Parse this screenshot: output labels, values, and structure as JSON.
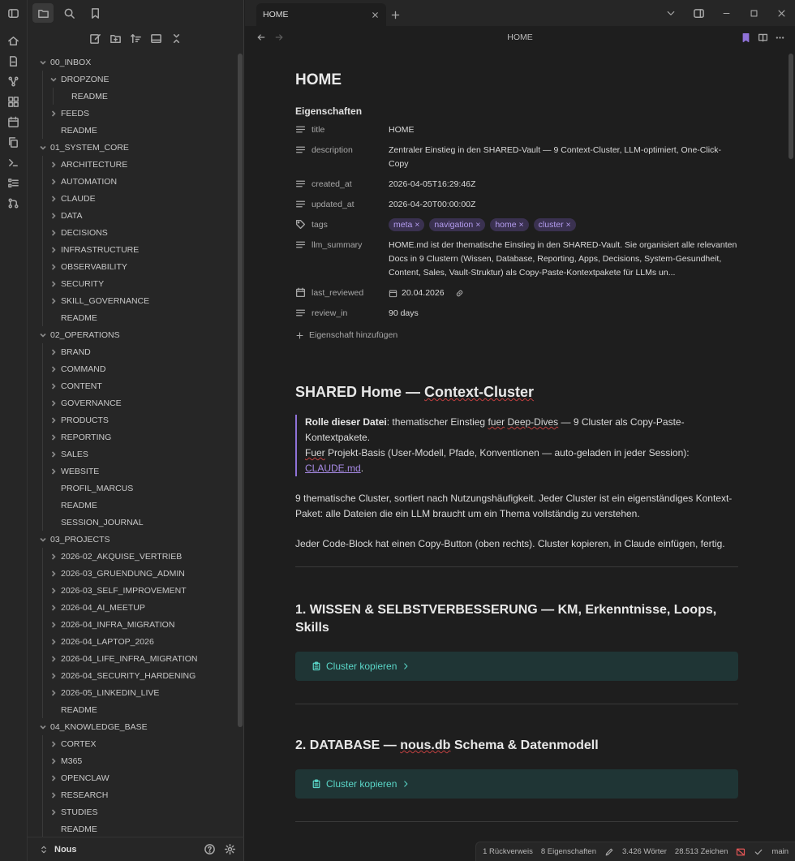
{
  "sidebar": {
    "footer": {
      "vault": "Nous"
    },
    "tree": [
      {
        "label": "00_INBOX",
        "depth": 0,
        "folder": true,
        "open": true
      },
      {
        "label": "DROPZONE",
        "depth": 1,
        "folder": true,
        "open": true
      },
      {
        "label": "README",
        "depth": 2,
        "folder": false
      },
      {
        "label": "FEEDS",
        "depth": 1,
        "folder": true,
        "open": false
      },
      {
        "label": "README",
        "depth": 1,
        "folder": false
      },
      {
        "label": "01_SYSTEM_CORE",
        "depth": 0,
        "folder": true,
        "open": true
      },
      {
        "label": "ARCHITECTURE",
        "depth": 1,
        "folder": true,
        "open": false
      },
      {
        "label": "AUTOMATION",
        "depth": 1,
        "folder": true,
        "open": false
      },
      {
        "label": "CLAUDE",
        "depth": 1,
        "folder": true,
        "open": false
      },
      {
        "label": "DATA",
        "depth": 1,
        "folder": true,
        "open": false
      },
      {
        "label": "DECISIONS",
        "depth": 1,
        "folder": true,
        "open": false
      },
      {
        "label": "INFRASTRUCTURE",
        "depth": 1,
        "folder": true,
        "open": false
      },
      {
        "label": "OBSERVABILITY",
        "depth": 1,
        "folder": true,
        "open": false
      },
      {
        "label": "SECURITY",
        "depth": 1,
        "folder": true,
        "open": false
      },
      {
        "label": "SKILL_GOVERNANCE",
        "depth": 1,
        "folder": true,
        "open": false
      },
      {
        "label": "README",
        "depth": 1,
        "folder": false
      },
      {
        "label": "02_OPERATIONS",
        "depth": 0,
        "folder": true,
        "open": true
      },
      {
        "label": "BRAND",
        "depth": 1,
        "folder": true,
        "open": false
      },
      {
        "label": "COMMAND",
        "depth": 1,
        "folder": true,
        "open": false
      },
      {
        "label": "CONTENT",
        "depth": 1,
        "folder": true,
        "open": false
      },
      {
        "label": "GOVERNANCE",
        "depth": 1,
        "folder": true,
        "open": false
      },
      {
        "label": "PRODUCTS",
        "depth": 1,
        "folder": true,
        "open": false
      },
      {
        "label": "REPORTING",
        "depth": 1,
        "folder": true,
        "open": false
      },
      {
        "label": "SALES",
        "depth": 1,
        "folder": true,
        "open": false
      },
      {
        "label": "WEBSITE",
        "depth": 1,
        "folder": true,
        "open": false
      },
      {
        "label": "PROFIL_MARCUS",
        "depth": 1,
        "folder": false
      },
      {
        "label": "README",
        "depth": 1,
        "folder": false
      },
      {
        "label": "SESSION_JOURNAL",
        "depth": 1,
        "folder": false
      },
      {
        "label": "03_PROJECTS",
        "depth": 0,
        "folder": true,
        "open": true
      },
      {
        "label": "2026-02_AKQUISE_VERTRIEB",
        "depth": 1,
        "folder": true,
        "open": false
      },
      {
        "label": "2026-03_GRUENDUNG_ADMIN",
        "depth": 1,
        "folder": true,
        "open": false
      },
      {
        "label": "2026-03_SELF_IMPROVEMENT",
        "depth": 1,
        "folder": true,
        "open": false
      },
      {
        "label": "2026-04_AI_MEETUP",
        "depth": 1,
        "folder": true,
        "open": false
      },
      {
        "label": "2026-04_INFRA_MIGRATION",
        "depth": 1,
        "folder": true,
        "open": false
      },
      {
        "label": "2026-04_LAPTOP_2026",
        "depth": 1,
        "folder": true,
        "open": false
      },
      {
        "label": "2026-04_LIFE_INFRA_MIGRATION",
        "depth": 1,
        "folder": true,
        "open": false
      },
      {
        "label": "2026-04_SECURITY_HARDENING",
        "depth": 1,
        "folder": true,
        "open": false
      },
      {
        "label": "2026-05_LINKEDIN_LIVE",
        "depth": 1,
        "folder": true,
        "open": false
      },
      {
        "label": "README",
        "depth": 1,
        "folder": false
      },
      {
        "label": "04_KNOWLEDGE_BASE",
        "depth": 0,
        "folder": true,
        "open": true
      },
      {
        "label": "CORTEX",
        "depth": 1,
        "folder": true,
        "open": false
      },
      {
        "label": "M365",
        "depth": 1,
        "folder": true,
        "open": false
      },
      {
        "label": "OPENCLAW",
        "depth": 1,
        "folder": true,
        "open": false
      },
      {
        "label": "RESEARCH",
        "depth": 1,
        "folder": true,
        "open": false
      },
      {
        "label": "STUDIES",
        "depth": 1,
        "folder": true,
        "open": false
      },
      {
        "label": "README",
        "depth": 1,
        "folder": false
      }
    ]
  },
  "tab": {
    "title": "HOME"
  },
  "view": {
    "title": "HOME"
  },
  "doc": {
    "title": "HOME",
    "properties_heading": "Eigenschaften",
    "props": {
      "title": {
        "key": "title",
        "value": "HOME"
      },
      "description": {
        "key": "description",
        "value": "Zentraler Einstieg in den SHARED-Vault — 9 Context-Cluster, LLM-optimiert, One-Click-Copy"
      },
      "created_at": {
        "key": "created_at",
        "value": "2026-04-05T16:29:46Z"
      },
      "updated_at": {
        "key": "updated_at",
        "value": "2026-04-20T00:00:00Z"
      },
      "tags": {
        "key": "tags",
        "values": [
          "meta",
          "navigation",
          "home",
          "cluster"
        ]
      },
      "llm_summary": {
        "key": "llm_summary",
        "value": "HOME.md ist der thematische Einstieg in den SHARED-Vault. Sie organisiert alle relevanten Docs in 9 Clustern (Wissen, Database, Reporting, Apps, Decisions, System-Gesundheit, Content, Sales, Vault-Struktur) als Copy-Paste-Kontextpakete für LLMs un..."
      },
      "last_reviewed": {
        "key": "last_reviewed",
        "value": "20.04.2026"
      },
      "review_in": {
        "key": "review_in",
        "value": "90 days"
      }
    },
    "add_property": "Eigenschaft hinzufügen",
    "h2": {
      "pre": "SHARED Home — ",
      "sq": "Context-Cluster"
    },
    "callout": {
      "bold": "Rolle dieser Datei",
      "t1": ": thematischer Einstieg ",
      "sq1": "fuer",
      "t2": " ",
      "sq2": "Deep-Dives",
      "t3": " — 9 Cluster als Copy-Paste-Kontextpakete.",
      "sq3": "Fuer",
      "t4": " Projekt-Basis (User-Modell, Pfade, Konventionen — auto-geladen in jeder Session): ",
      "link": "CLAUDE.md",
      "t5": "."
    },
    "para1": "9 thematische Cluster, sortiert nach Nutzungshäufigkeit. Jeder Cluster ist ein eigenständiges Kontext-Paket: alle Dateien die ein LLM braucht um ein Thema vollständig zu verstehen.",
    "para2": "Jeder Code-Block hat einen Copy-Button (oben rechts). Cluster kopieren, in Claude einfügen, fertig.",
    "sections": [
      {
        "title": "1. WISSEN & SELBSTVERBESSERUNG — KM, Erkenntnisse, Loops, Skills",
        "button": "Cluster kopieren"
      },
      {
        "title_pre": "2. DATABASE — ",
        "title_sq": "nous.db",
        "title_post": " Schema & Datenmodell",
        "button": "Cluster kopieren"
      }
    ]
  },
  "status": {
    "backlinks": "1 Rückverweis",
    "properties": "8 Eigenschaften",
    "words": "3.426 Wörter",
    "chars": "28.513 Zeichen",
    "branch": "main"
  },
  "colors": {
    "accent": "#8f72d8",
    "tag_bg": "#3a3150",
    "tag_fg": "#b49cf0",
    "cluster_bg": "#1f3535",
    "cluster_fg": "#5ad6c8"
  }
}
